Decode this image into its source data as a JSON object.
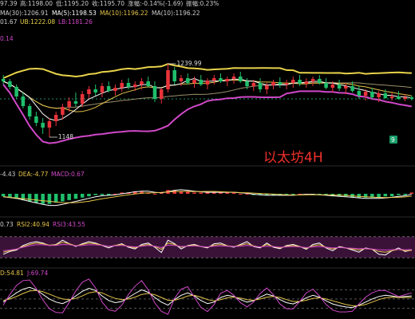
{
  "colors": {
    "bg": "#000000",
    "up": "#e8333a",
    "down": "#1fbf6b",
    "ma5": "#ffffff",
    "ma10": "#e7c54a",
    "ma30": "#d048c8",
    "ub": "#e8d24a",
    "lb": "#d048c8",
    "grid": "#333333",
    "rsi_band": "#3a1238"
  },
  "header": {
    "row1": [
      {
        "text": "97.39",
        "color": "#cccccc"
      },
      {
        "text": "高:1198.00",
        "color": "#cccccc"
      },
      {
        "text": "低:1195.20",
        "color": "#cccccc"
      },
      {
        "text": "收:1195.70",
        "color": "#cccccc"
      },
      {
        "text": "涨幅:-0.14%(-1.69)",
        "color": "#cccccc"
      },
      {
        "text": "振幅:0.23%",
        "color": "#cccccc"
      }
    ],
    "row2": [
      {
        "text": "MA(30):1206.91",
        "color": "#cccccc"
      },
      {
        "text": "MA(5):1198.53",
        "color": "#ffffff"
      },
      {
        "text": "MA(10):1196.22",
        "color": "#e7c54a"
      },
      {
        "text": "MA(10):1196.22",
        "color": "#cccccc"
      }
    ],
    "row3": [
      {
        "text": "01.67",
        "color": "#cccccc"
      },
      {
        "text": "UB:1222.08",
        "color": "#e8d24a"
      },
      {
        "text": "LB:1181.26",
        "color": "#d048c8"
      }
    ],
    "corner_label": "0.14"
  },
  "price_labels": {
    "high": "1239.99",
    "low": "1148"
  },
  "badge": "9",
  "watermark": "以太坊4H",
  "macd_header": [
    {
      "text": "-4.43",
      "color": "#cccccc"
    },
    {
      "text": "DEA:-4.77",
      "color": "#e7c54a"
    },
    {
      "text": "MACD:0.67",
      "color": "#d048c8"
    }
  ],
  "rsi_header": [
    {
      "text": "0.73",
      "color": "#cccccc"
    },
    {
      "text": "RSI2:40.94",
      "color": "#e7c54a"
    },
    {
      "text": "RSI3:43.55",
      "color": "#d048c8"
    }
  ],
  "kdj_header": [
    {
      "text": "D:54.81",
      "color": "#e7c54a"
    },
    {
      "text": "J:69.74",
      "color": "#d048c8"
    }
  ],
  "chart_data": {
    "type": "candlestick",
    "candles": [
      [
        1221,
        1226,
        1214,
        1218
      ],
      [
        1218,
        1221,
        1208,
        1211
      ],
      [
        1211,
        1214,
        1196,
        1199
      ],
      [
        1199,
        1204,
        1184,
        1187
      ],
      [
        1187,
        1190,
        1170,
        1174
      ],
      [
        1174,
        1180,
        1162,
        1166
      ],
      [
        1166,
        1172,
        1152,
        1160
      ],
      [
        1160,
        1172,
        1148,
        1168
      ],
      [
        1168,
        1180,
        1162,
        1176
      ],
      [
        1176,
        1190,
        1170,
        1186
      ],
      [
        1186,
        1198,
        1180,
        1193
      ],
      [
        1193,
        1204,
        1186,
        1190
      ],
      [
        1190,
        1206,
        1186,
        1202
      ],
      [
        1202,
        1212,
        1196,
        1208
      ],
      [
        1208,
        1214,
        1200,
        1204
      ],
      [
        1204,
        1216,
        1198,
        1212
      ],
      [
        1212,
        1218,
        1204,
        1206
      ],
      [
        1206,
        1214,
        1200,
        1210
      ],
      [
        1210,
        1220,
        1205,
        1216
      ],
      [
        1216,
        1222,
        1208,
        1211
      ],
      [
        1211,
        1218,
        1206,
        1214
      ],
      [
        1214,
        1222,
        1208,
        1218
      ],
      [
        1218,
        1224,
        1210,
        1212
      ],
      [
        1212,
        1218,
        1192,
        1196
      ],
      [
        1196,
        1210,
        1190,
        1208
      ],
      [
        1208,
        1240,
        1204,
        1232
      ],
      [
        1232,
        1236,
        1214,
        1218
      ],
      [
        1218,
        1226,
        1212,
        1222
      ],
      [
        1222,
        1228,
        1214,
        1216
      ],
      [
        1216,
        1224,
        1210,
        1220
      ],
      [
        1220,
        1226,
        1212,
        1214
      ],
      [
        1214,
        1222,
        1208,
        1219
      ],
      [
        1219,
        1226,
        1214,
        1222
      ],
      [
        1222,
        1228,
        1216,
        1218
      ],
      [
        1218,
        1224,
        1212,
        1221
      ],
      [
        1221,
        1228,
        1215,
        1224
      ],
      [
        1224,
        1230,
        1216,
        1218
      ],
      [
        1218,
        1222,
        1208,
        1212
      ],
      [
        1212,
        1220,
        1206,
        1216
      ],
      [
        1216,
        1222,
        1204,
        1208
      ],
      [
        1208,
        1216,
        1202,
        1213
      ],
      [
        1213,
        1220,
        1208,
        1217
      ],
      [
        1217,
        1223,
        1210,
        1214
      ],
      [
        1214,
        1220,
        1208,
        1216
      ],
      [
        1216,
        1224,
        1210,
        1220
      ],
      [
        1220,
        1226,
        1212,
        1215
      ],
      [
        1215,
        1222,
        1210,
        1218
      ],
      [
        1218,
        1224,
        1212,
        1221
      ],
      [
        1221,
        1226,
        1214,
        1216
      ],
      [
        1216,
        1222,
        1208,
        1210
      ],
      [
        1210,
        1218,
        1204,
        1214
      ],
      [
        1214,
        1220,
        1206,
        1209
      ],
      [
        1209,
        1216,
        1202,
        1212
      ],
      [
        1212,
        1218,
        1204,
        1206
      ],
      [
        1206,
        1212,
        1196,
        1200
      ],
      [
        1200,
        1208,
        1194,
        1205
      ],
      [
        1205,
        1210,
        1196,
        1198
      ],
      [
        1198,
        1206,
        1192,
        1203
      ],
      [
        1203,
        1208,
        1196,
        1197
      ],
      [
        1197,
        1204,
        1194,
        1199
      ],
      [
        1199,
        1206,
        1195,
        1196
      ],
      [
        1196,
        1202,
        1193,
        1198
      ],
      [
        1198,
        1200,
        1194,
        1196
      ]
    ],
    "price_range": [
      1115,
      1270
    ],
    "macd_hist": [
      -2,
      -3,
      -4,
      -5,
      -6,
      -7,
      -8,
      -8,
      -7,
      -6,
      -5,
      -4,
      -3,
      -2,
      -1,
      -1,
      -1,
      0,
      1,
      1,
      2,
      2,
      1,
      0,
      1,
      3,
      3,
      2,
      2,
      1,
      1,
      1,
      1,
      1,
      1,
      1,
      0,
      0,
      -1,
      -1,
      -1,
      -1,
      -1,
      -1,
      -1,
      0,
      0,
      -1,
      -1,
      -1,
      -2,
      -2,
      -2,
      -3,
      -3,
      -3,
      -3,
      -3,
      -2,
      -2,
      -1,
      -1,
      1
    ],
    "macd_range": [
      -12,
      12
    ],
    "rsi1": [
      30,
      38,
      42,
      55,
      62,
      66,
      62,
      55,
      58,
      70,
      60,
      52,
      60,
      66,
      62,
      55,
      48,
      55,
      60,
      50,
      45,
      58,
      62,
      50,
      35,
      70,
      60,
      45,
      55,
      58,
      52,
      48,
      60,
      62,
      54,
      50,
      58,
      66,
      52,
      48,
      62,
      50,
      46,
      55,
      58,
      52,
      44,
      58,
      62,
      48,
      40,
      52,
      48,
      42,
      36,
      48,
      44,
      30,
      28,
      40,
      48,
      38,
      42
    ],
    "rsi2": [
      36,
      40,
      44,
      52,
      58,
      62,
      60,
      56,
      57,
      64,
      60,
      54,
      58,
      62,
      60,
      56,
      52,
      55,
      58,
      52,
      48,
      55,
      58,
      52,
      44,
      62,
      58,
      50,
      54,
      56,
      52,
      50,
      56,
      58,
      54,
      52,
      56,
      60,
      54,
      50,
      58,
      52,
      48,
      53,
      55,
      52,
      47,
      54,
      57,
      50,
      45,
      50,
      48,
      45,
      42,
      46,
      44,
      38,
      36,
      40,
      44,
      40,
      41
    ],
    "rsi3": [
      40,
      42,
      45,
      50,
      54,
      57,
      57,
      55,
      55,
      58,
      57,
      54,
      55,
      57,
      57,
      55,
      53,
      54,
      55,
      53,
      51,
      53,
      55,
      53,
      49,
      56,
      55,
      52,
      53,
      54,
      52,
      51,
      53,
      54,
      53,
      52,
      53,
      55,
      53,
      51,
      53,
      52,
      50,
      51,
      52,
      51,
      49,
      51,
      52,
      50,
      48,
      49,
      48,
      47,
      46,
      46,
      45,
      43,
      42,
      43,
      44,
      43,
      43.5
    ],
    "k": [
      40,
      55,
      70,
      82,
      88,
      80,
      65,
      50,
      40,
      35,
      45,
      60,
      75,
      85,
      78,
      60,
      45,
      38,
      42,
      55,
      68,
      80,
      72,
      55,
      40,
      30,
      48,
      62,
      70,
      60,
      45,
      35,
      40,
      55,
      62,
      58,
      48,
      40,
      44,
      56,
      66,
      60,
      48,
      38,
      34,
      42,
      54,
      62,
      56,
      44,
      34,
      28,
      24,
      22,
      30,
      40,
      50,
      58,
      62,
      60,
      56,
      58,
      60
    ],
    "d": [
      45,
      50,
      58,
      68,
      76,
      78,
      74,
      66,
      57,
      50,
      48,
      52,
      60,
      70,
      74,
      70,
      60,
      52,
      48,
      50,
      56,
      65,
      68,
      64,
      55,
      46,
      46,
      52,
      60,
      62,
      56,
      48,
      44,
      48,
      54,
      56,
      53,
      48,
      46,
      50,
      56,
      58,
      55,
      48,
      42,
      42,
      46,
      52,
      54,
      50,
      44,
      38,
      32,
      28,
      28,
      32,
      40,
      48,
      54,
      56,
      55,
      55,
      54.81
    ],
    "j": [
      30,
      65,
      94,
      110,
      112,
      84,
      47,
      18,
      6,
      5,
      39,
      76,
      105,
      115,
      86,
      40,
      15,
      10,
      30,
      65,
      92,
      110,
      80,
      37,
      10,
      0,
      52,
      82,
      90,
      56,
      23,
      9,
      32,
      69,
      78,
      62,
      38,
      24,
      40,
      68,
      86,
      64,
      34,
      18,
      18,
      42,
      70,
      82,
      60,
      32,
      14,
      8,
      8,
      10,
      34,
      56,
      70,
      78,
      78,
      68,
      58,
      64,
      69.74
    ],
    "osc_range": [
      -10,
      120
    ]
  }
}
